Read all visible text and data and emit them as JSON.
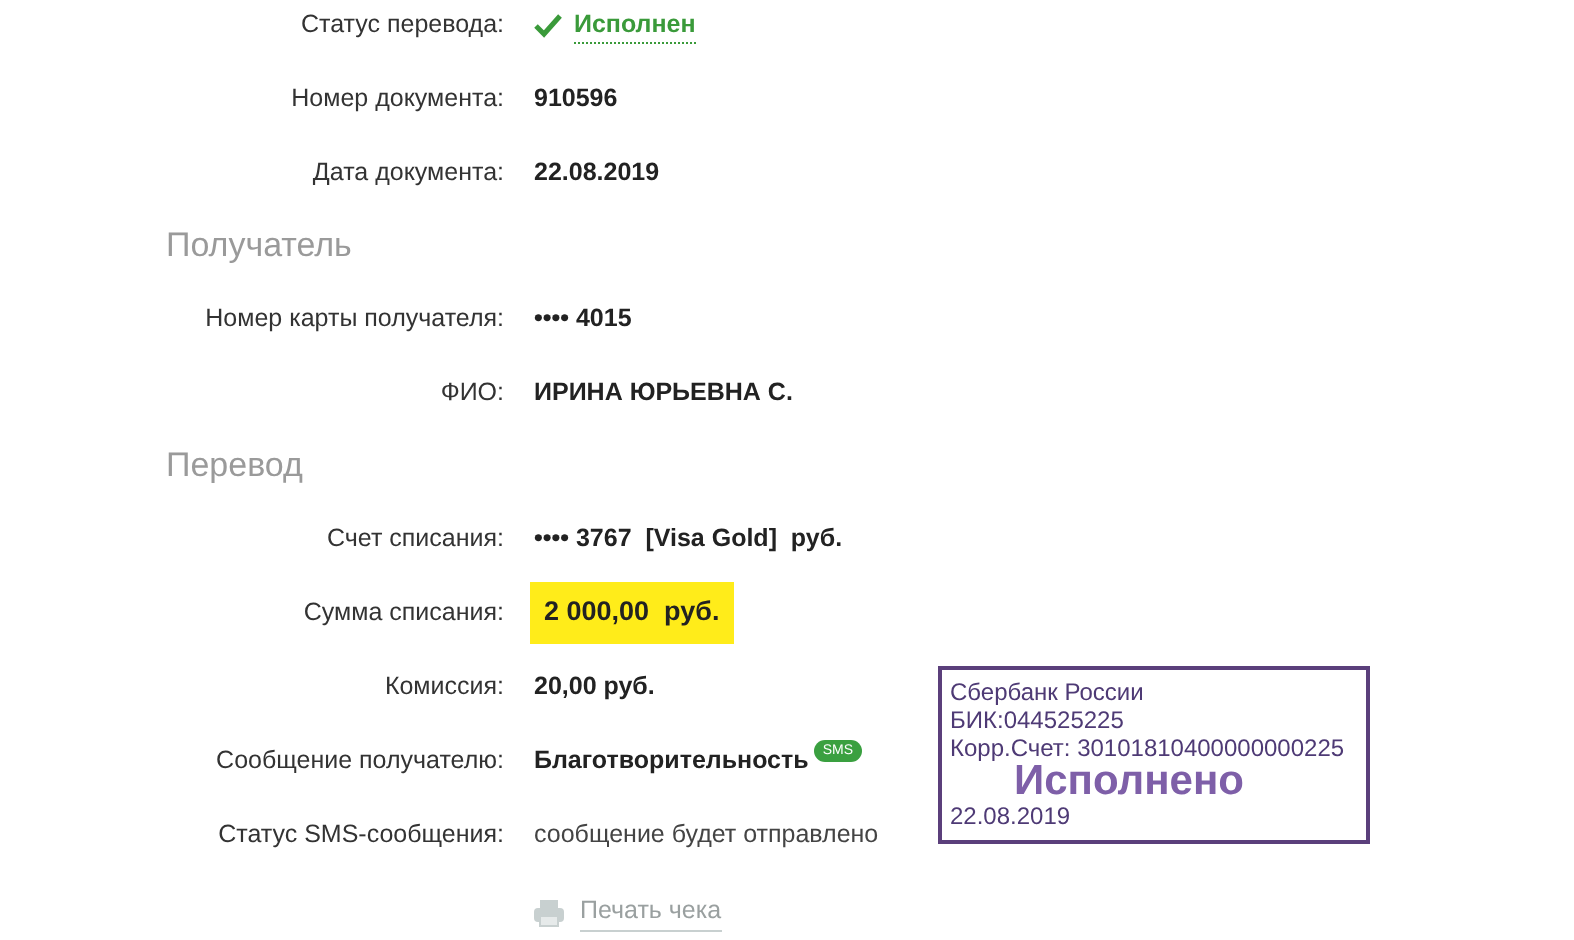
{
  "sections": [
    {
      "rows": [
        {
          "kind": "status",
          "label": "Статус перевода:",
          "value": "Исполнен"
        },
        {
          "kind": "bold",
          "label": "Номер документа:",
          "value": "910596"
        },
        {
          "kind": "bold",
          "label": "Дата документа:",
          "value": "22.08.2019"
        }
      ]
    },
    {
      "heading": "Получатель",
      "rows": [
        {
          "kind": "bold",
          "label": "Номер карты получателя:",
          "value": "•••• 4015"
        },
        {
          "kind": "bold",
          "label": "ФИО:",
          "value": "ИРИНА ЮРЬЕВНА С."
        }
      ]
    },
    {
      "heading": "Перевод",
      "rows": [
        {
          "kind": "bold",
          "label": "Счет списания:",
          "value": "•••• 3767  [Visa Gold]  руб."
        },
        {
          "kind": "highlight",
          "label": "Сумма списания:",
          "value": "2 000,00  руб."
        },
        {
          "kind": "bold",
          "label": "Комиссия:",
          "value": "20,00 руб."
        },
        {
          "kind": "sms",
          "label": "Сообщение получателю:",
          "value": "Благотворительность",
          "icon_text": "SMS"
        },
        {
          "kind": "note",
          "label": "Статус SMS-сообщения:",
          "value": "сообщение будет отправлено"
        }
      ]
    }
  ],
  "print_link": "Печать чека",
  "stamp": {
    "lines": [
      "Сбербанк России",
      "БИК:044525225",
      "Корр.Счет: 30101810400000000225"
    ],
    "status": "Исполнено",
    "date": "22.08.2019"
  }
}
